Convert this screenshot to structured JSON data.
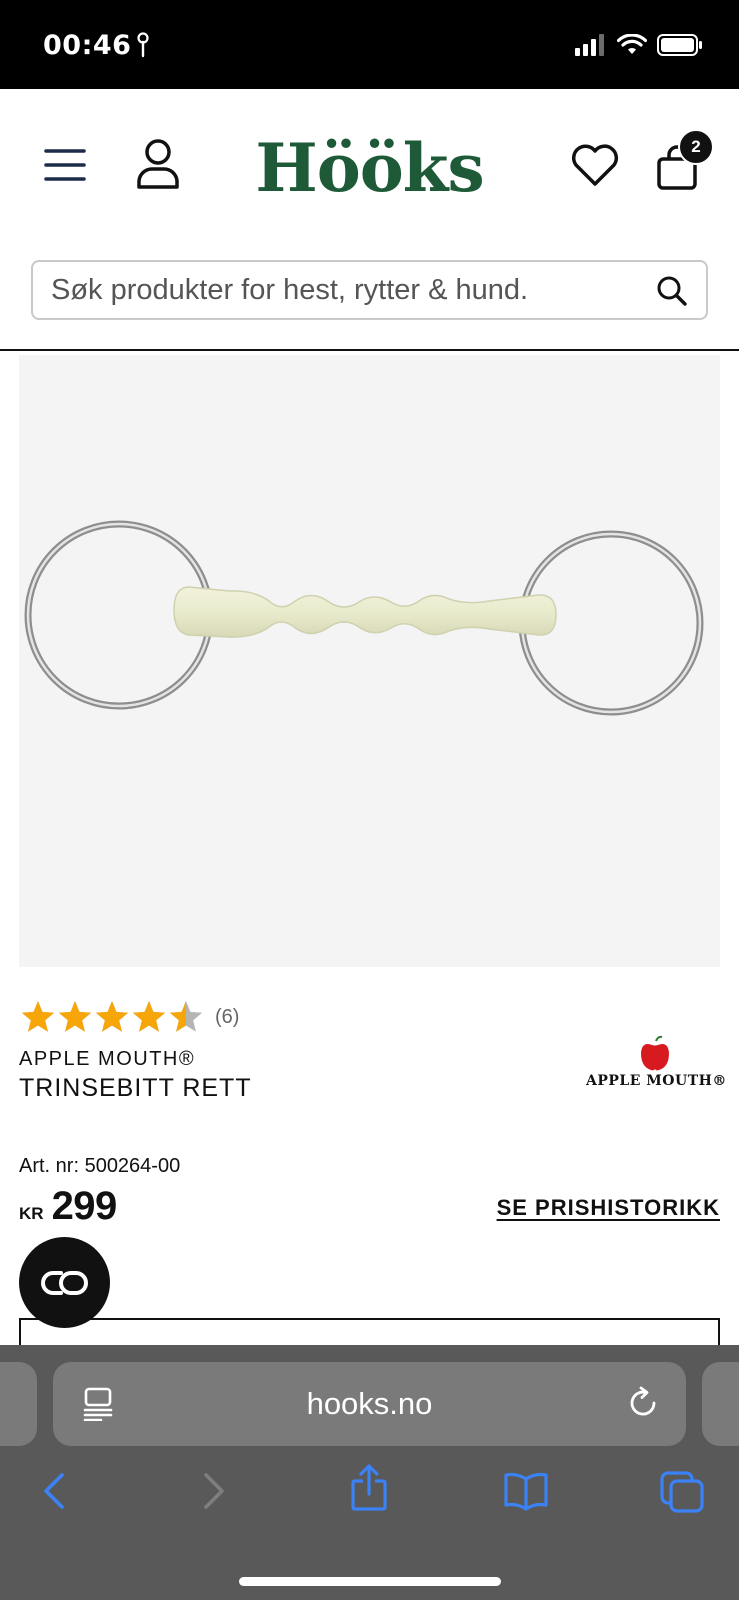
{
  "status_bar": {
    "time": "00:46",
    "icons": [
      "location-icon",
      "signal-icon",
      "wifi-icon",
      "battery-icon"
    ]
  },
  "header": {
    "logo": "Hööks",
    "cart_count": "2",
    "icons": [
      "menu-icon",
      "user-icon",
      "heart-icon",
      "cart-icon"
    ],
    "brand_color": "#1e5a37"
  },
  "search": {
    "placeholder": "Søk produkter for hest, rytter & hund."
  },
  "product": {
    "rating": 4.5,
    "rating_max": 5,
    "rating_count": "(6)",
    "brand": "APPLE MOUTH®",
    "name": "TRINSEBITT RETT",
    "brand_logo_text": "APPLE MOUTH®",
    "article_number": "Art. nr: 500264-00",
    "currency": "KR",
    "price": "299",
    "price_history_link": "SE PRISHISTORIKK",
    "star_color": "#f6a609"
  },
  "browser": {
    "url": "hooks.no",
    "toolbar": [
      "back-icon",
      "forward-icon",
      "share-icon",
      "bookmarks-icon",
      "tabs-icon"
    ],
    "accent": "#3b82f6"
  }
}
